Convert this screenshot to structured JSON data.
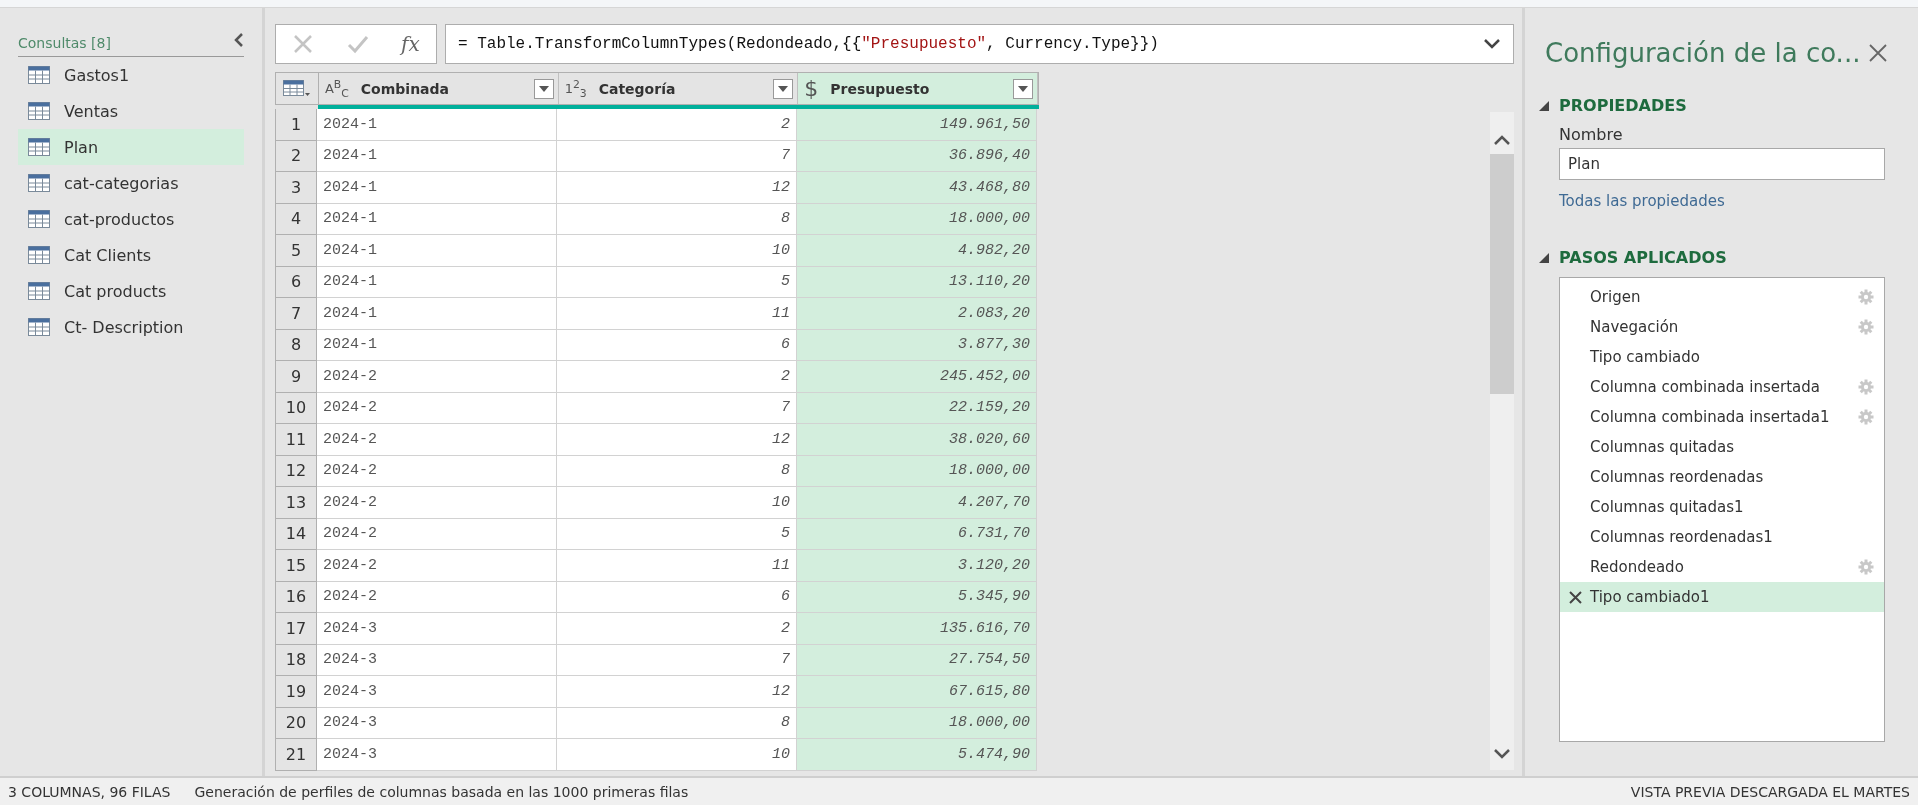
{
  "queries": {
    "title": "Consultas [8]",
    "items": [
      {
        "label": "Gastos1",
        "selected": false
      },
      {
        "label": "Ventas",
        "selected": false
      },
      {
        "label": "Plan",
        "selected": true
      },
      {
        "label": "cat-categorias",
        "selected": false
      },
      {
        "label": "cat-productos",
        "selected": false
      },
      {
        "label": "Cat Clients",
        "selected": false
      },
      {
        "label": "Cat products",
        "selected": false
      },
      {
        "label": "Ct- Description",
        "selected": false
      }
    ]
  },
  "formula_bar": {
    "fx": "fx",
    "parts": [
      {
        "kind": "code",
        "text": "= Table.TransformColumnTypes(Redondeado,{{"
      },
      {
        "kind": "string",
        "text": "\"Presupuesto\""
      },
      {
        "kind": "code",
        "text": ", Currency.Type}})"
      }
    ]
  },
  "table": {
    "columns": [
      {
        "name": "Combinada",
        "kind": "text",
        "type_label": "A$^{B}$$_{C}$",
        "selected": false
      },
      {
        "name": "Categoría",
        "kind": "number",
        "type_label": "1$^{2}$$_{3}$",
        "selected": false
      },
      {
        "name": "Presupuesto",
        "kind": "currency",
        "type_label": "$",
        "selected": true
      }
    ],
    "rows": [
      {
        "n": "1",
        "cells": [
          "2024-1",
          "2",
          "149.961,50"
        ]
      },
      {
        "n": "2",
        "cells": [
          "2024-1",
          "7",
          "36.896,40"
        ]
      },
      {
        "n": "3",
        "cells": [
          "2024-1",
          "12",
          "43.468,80"
        ]
      },
      {
        "n": "4",
        "cells": [
          "2024-1",
          "8",
          "18.000,00"
        ]
      },
      {
        "n": "5",
        "cells": [
          "2024-1",
          "10",
          "4.982,20"
        ]
      },
      {
        "n": "6",
        "cells": [
          "2024-1",
          "5",
          "13.110,20"
        ]
      },
      {
        "n": "7",
        "cells": [
          "2024-1",
          "11",
          "2.083,20"
        ]
      },
      {
        "n": "8",
        "cells": [
          "2024-1",
          "6",
          "3.877,30"
        ]
      },
      {
        "n": "9",
        "cells": [
          "2024-2",
          "2",
          "245.452,00"
        ]
      },
      {
        "n": "10",
        "cells": [
          "2024-2",
          "7",
          "22.159,20"
        ]
      },
      {
        "n": "11",
        "cells": [
          "2024-2",
          "12",
          "38.020,60"
        ]
      },
      {
        "n": "12",
        "cells": [
          "2024-2",
          "8",
          "18.000,00"
        ]
      },
      {
        "n": "13",
        "cells": [
          "2024-2",
          "10",
          "4.207,70"
        ]
      },
      {
        "n": "14",
        "cells": [
          "2024-2",
          "5",
          "6.731,70"
        ]
      },
      {
        "n": "15",
        "cells": [
          "2024-2",
          "11",
          "3.120,20"
        ]
      },
      {
        "n": "16",
        "cells": [
          "2024-2",
          "6",
          "5.345,90"
        ]
      },
      {
        "n": "17",
        "cells": [
          "2024-3",
          "2",
          "135.616,70"
        ]
      },
      {
        "n": "18",
        "cells": [
          "2024-3",
          "7",
          "27.754,50"
        ]
      },
      {
        "n": "19",
        "cells": [
          "2024-3",
          "12",
          "67.615,80"
        ]
      },
      {
        "n": "20",
        "cells": [
          "2024-3",
          "8",
          "18.000,00"
        ]
      },
      {
        "n": "21",
        "cells": [
          "2024-3",
          "10",
          "5.474,90"
        ]
      }
    ]
  },
  "settings": {
    "title": "Configuración de la co...",
    "properties": {
      "heading": "PROPIEDADES",
      "name_label": "Nombre",
      "name_value": "Plan",
      "link": "Todas las propiedades"
    },
    "steps": {
      "heading": "PASOS APLICADOS",
      "items": [
        {
          "label": "Origen",
          "has_settings": true,
          "selected": false
        },
        {
          "label": "Navegación",
          "has_settings": true,
          "selected": false
        },
        {
          "label": "Tipo cambiado",
          "has_settings": false,
          "selected": false
        },
        {
          "label": "Columna combinada insertada",
          "has_settings": true,
          "selected": false
        },
        {
          "label": "Columna combinada insertada1",
          "has_settings": true,
          "selected": false
        },
        {
          "label": "Columnas quitadas",
          "has_settings": false,
          "selected": false
        },
        {
          "label": "Columnas reordenadas",
          "has_settings": false,
          "selected": false
        },
        {
          "label": "Columnas quitadas1",
          "has_settings": false,
          "selected": false
        },
        {
          "label": "Columnas reordenadas1",
          "has_settings": false,
          "selected": false
        },
        {
          "label": "Redondeado",
          "has_settings": true,
          "selected": false
        },
        {
          "label": "Tipo cambiado1",
          "has_settings": false,
          "selected": true
        }
      ]
    }
  },
  "status_bar": {
    "counts": "3 COLUMNAS, 96 FILAS",
    "profiling": "Generación de perfiles de columnas basada en las 1000 primeras filas",
    "preview": "VISTA PREVIA DESCARGADA EL MARTES"
  }
}
